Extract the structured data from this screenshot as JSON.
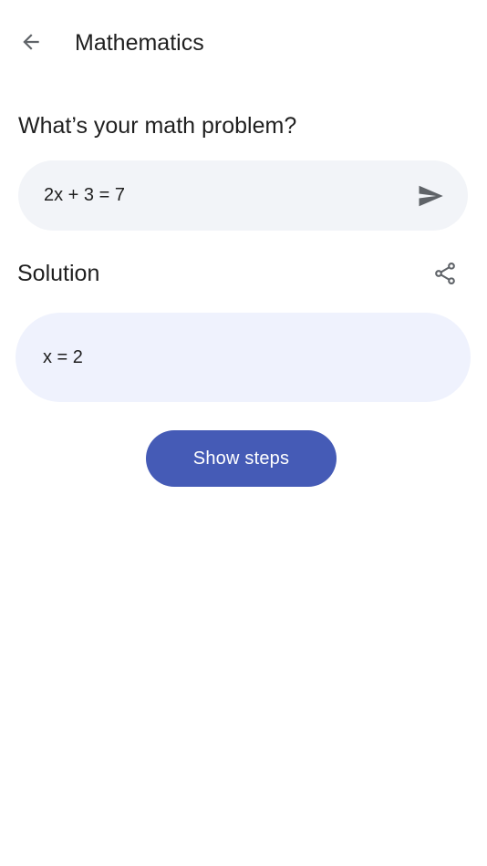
{
  "header": {
    "title": "Mathematics",
    "back_icon": "arrow-left-icon"
  },
  "problem": {
    "heading": "What’s your math problem?",
    "input_value": "2x + 3 = 7",
    "send_icon": "send-icon"
  },
  "solution": {
    "heading": "Solution",
    "share_icon": "share-icon",
    "value": "x = 2"
  },
  "actions": {
    "show_steps_label": "Show steps"
  },
  "colors": {
    "primary": "#455bb6",
    "field_background": "#f2f4f8",
    "solution_background": "#eff2fd",
    "icon": "#5f6368"
  }
}
